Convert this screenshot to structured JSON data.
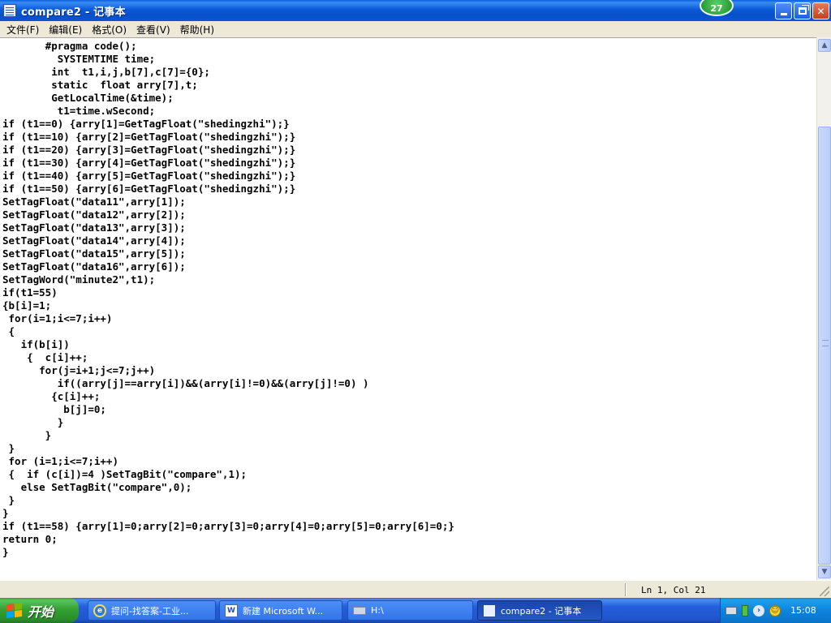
{
  "window": {
    "title": "compare2 - 记事本",
    "badge_count": "27"
  },
  "menu": {
    "items": [
      "文件(F)",
      "编辑(E)",
      "格式(O)",
      "查看(V)",
      "帮助(H)"
    ]
  },
  "editor": {
    "content": "       #pragma code();\n         SYSTEMTIME time;\n        int  t1,i,j,b[7],c[7]={0};\n        static  float arry[7],t;\n        GetLocalTime(&time);\n         t1=time.wSecond;\nif (t1==0) {arry[1]=GetTagFloat(\"shedingzhi\");}\nif (t1==10) {arry[2]=GetTagFloat(\"shedingzhi\");}\nif (t1==20) {arry[3]=GetTagFloat(\"shedingzhi\");}\nif (t1==30) {arry[4]=GetTagFloat(\"shedingzhi\");}\nif (t1==40) {arry[5]=GetTagFloat(\"shedingzhi\");}\nif (t1==50) {arry[6]=GetTagFloat(\"shedingzhi\");}\nSetTagFloat(\"data11\",arry[1]);\nSetTagFloat(\"data12\",arry[2]);\nSetTagFloat(\"data13\",arry[3]);\nSetTagFloat(\"data14\",arry[4]);\nSetTagFloat(\"data15\",arry[5]);\nSetTagFloat(\"data16\",arry[6]);\nSetTagWord(\"minute2\",t1);\nif(t1=55)\n{b[i]=1;\n for(i=1;i<=7;i++)\n {\n   if(b[i])\n    {  c[i]++;\n      for(j=i+1;j<=7;j++)\n         if((arry[j]==arry[i])&&(arry[i]!=0)&&(arry[j]!=0) )\n        {c[i]++;\n          b[j]=0;\n         }\n       }\n }\n for (i=1;i<=7;i++)\n {  if (c[i])=4 )SetTagBit(\"compare\",1);\n   else SetTagBit(\"compare\",0);\n }\n}\nif (t1==58) {arry[1]=0;arry[2]=0;arry[3]=0;arry[4]=0;arry[5]=0;arry[6]=0;}\nreturn 0;\n}"
  },
  "status": {
    "position": "Ln 1, Col 21"
  },
  "taskbar": {
    "start_label": "开始",
    "tasks": [
      {
        "label": "提问-找答案-工业...",
        "icon": "ie-icon"
      },
      {
        "label": "新建 Microsoft W...",
        "icon": "word-icon"
      },
      {
        "label": "H:\\",
        "icon": "drive-icon"
      },
      {
        "label": "compare2 - 记事本",
        "icon": "notepad-icon"
      }
    ],
    "clock": "15:08"
  },
  "colors": {
    "titlebar": "#0b5ad9",
    "taskbar": "#245edb",
    "start": "#33a233",
    "tray": "#0d84de"
  }
}
